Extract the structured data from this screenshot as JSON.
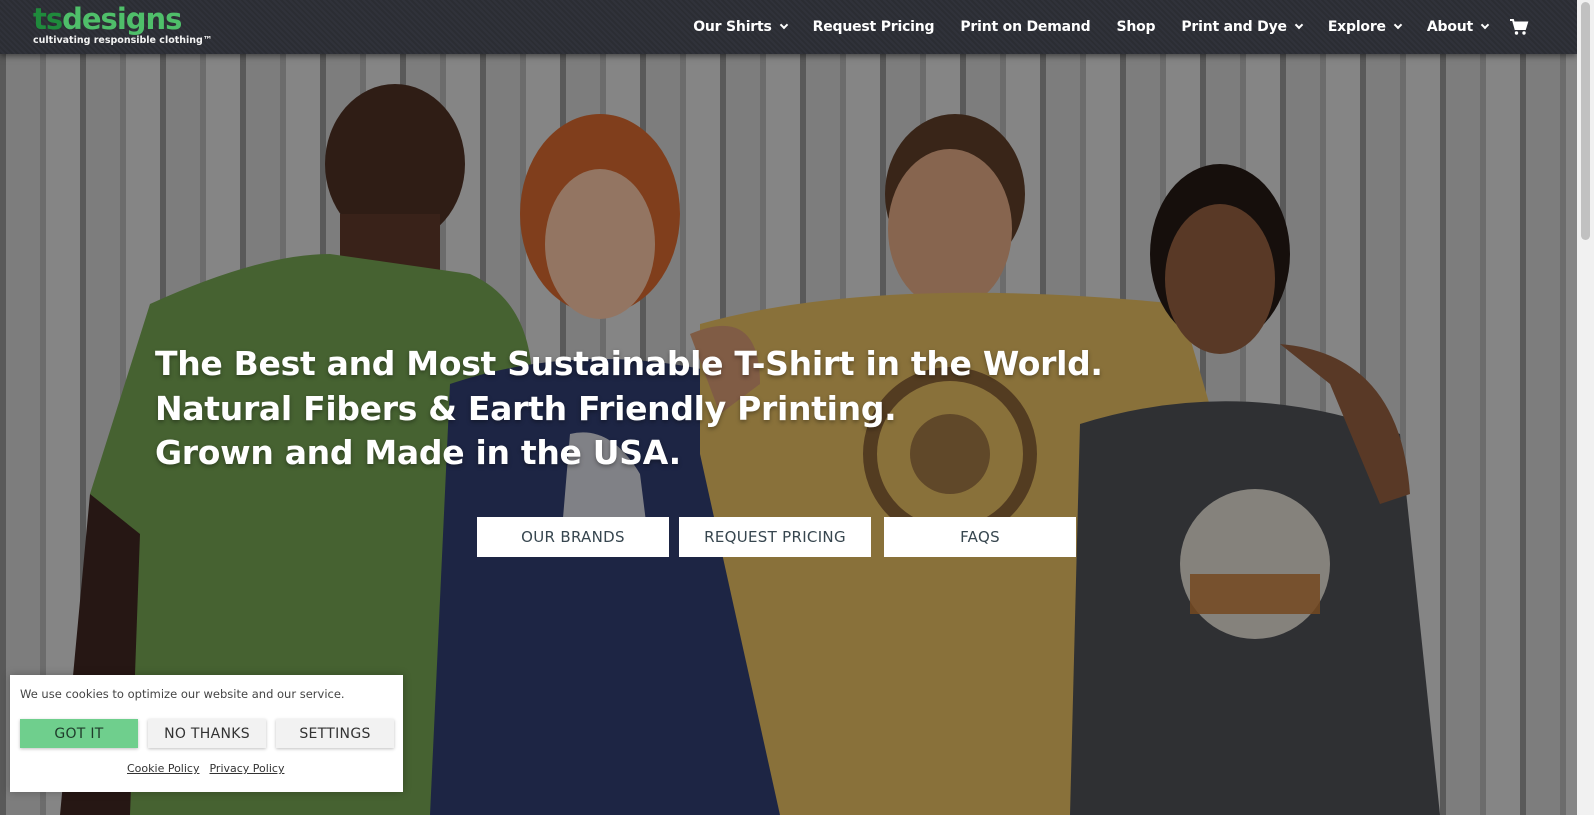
{
  "logo": {
    "ts": "ts",
    "designs": "designs",
    "tagline": "cultivating responsible clothing™"
  },
  "nav": {
    "items": [
      {
        "label": "Our Shirts",
        "dropdown": true
      },
      {
        "label": "Request Pricing",
        "dropdown": false
      },
      {
        "label": "Print on Demand",
        "dropdown": false
      },
      {
        "label": "Shop",
        "dropdown": false
      },
      {
        "label": "Print and Dye",
        "dropdown": true
      },
      {
        "label": "Explore",
        "dropdown": true
      },
      {
        "label": "About",
        "dropdown": true
      }
    ],
    "cart_icon": "shopping-cart-icon"
  },
  "hero": {
    "lines": [
      "The Best and Most Sustainable T-Shirt in the World.",
      "Natural Fibers & Earth Friendly Printing.",
      "Grown and Made in the USA."
    ],
    "buttons": [
      "OUR BRANDS",
      "REQUEST PRICING",
      "FAQS"
    ]
  },
  "cookie": {
    "message": "We use cookies to optimize our website and our service.",
    "accept": "GOT IT",
    "decline": "NO THANKS",
    "settings": "SETTINGS",
    "cookie_policy": "Cookie Policy",
    "privacy_policy": "Privacy Policy"
  },
  "colors": {
    "header_bg": "#2b2d33",
    "logo_green": "#4fbf6a",
    "accept_green": "#6fcf8d"
  }
}
